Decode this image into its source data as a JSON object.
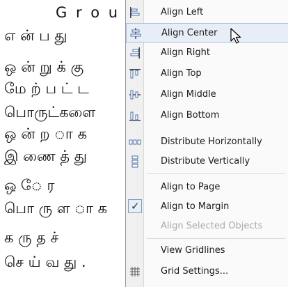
{
  "document": {
    "lines": [
      "G r o u p",
      "எ ன் ப து",
      "ஒ ன் று க் கு",
      "மே ற் ப ட் ட",
      "பொருட்களை",
      "ஒ ன் ற ா க",
      "இ ணை த் து",
      "ஒ  ே  ர",
      "பொ ரு ள ா க",
      "க  ரு  த  ச்",
      "செ ய் வ து ."
    ]
  },
  "menu": {
    "items": [
      {
        "label": "Align Left",
        "icon": "align-left-icon"
      },
      {
        "label": "Align Center",
        "icon": "align-center-icon",
        "hovered": true
      },
      {
        "label": "Align Right",
        "icon": "align-right-icon"
      },
      {
        "label": "Align Top",
        "icon": "align-top-icon"
      },
      {
        "label": "Align Middle",
        "icon": "align-middle-icon"
      },
      {
        "label": "Align Bottom",
        "icon": "align-bottom-icon"
      },
      {
        "label": "Distribute Horizontally",
        "icon": "distribute-horizontally-icon"
      },
      {
        "label": "Distribute Vertically",
        "icon": "distribute-vertically-icon"
      },
      {
        "label": "Align to Page",
        "icon": ""
      },
      {
        "label": "Align to Margin",
        "icon": "checkmark-icon",
        "checked": true
      },
      {
        "label": "Align Selected Objects",
        "icon": "",
        "disabled": true
      },
      {
        "label": "View Gridlines",
        "icon": ""
      },
      {
        "label": "Grid Settings...",
        "icon": "grid-icon"
      }
    ],
    "checkmark": "✓"
  }
}
